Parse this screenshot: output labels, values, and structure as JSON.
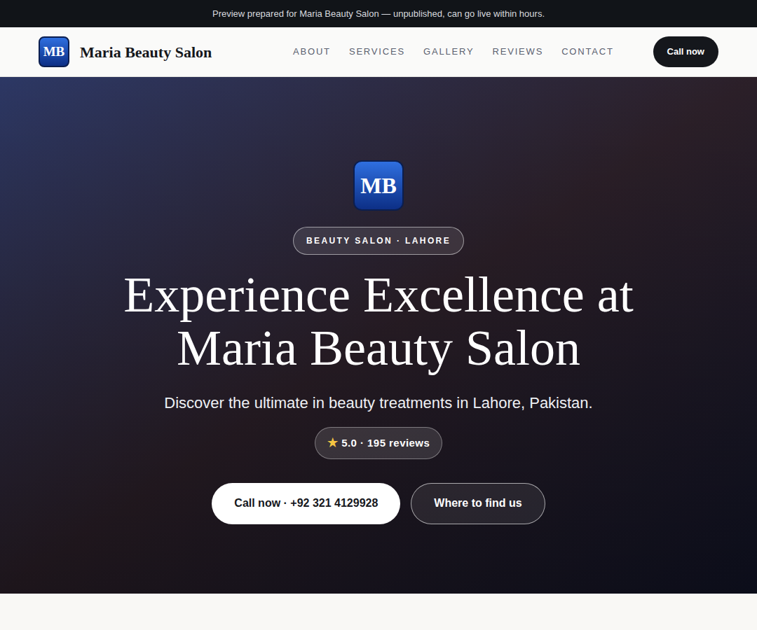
{
  "announcement": "Preview prepared for Maria Beauty Salon — unpublished, can go live within hours.",
  "header": {
    "logo": "MB",
    "title": "Maria Beauty Salon",
    "nav": [
      "ABOUT",
      "SERVICES",
      "GALLERY",
      "REVIEWS",
      "CONTACT"
    ],
    "cta": "Call now"
  },
  "hero": {
    "logo": "MB",
    "badge": "BEAUTY SALON · LAHORE",
    "heading": "Experience Excellence at Maria Beauty Salon",
    "subtitle": "Discover the ultimate in beauty treatments in Lahore, Pakistan.",
    "rating": {
      "icon": "★",
      "text": "5.0 · 195 reviews"
    },
    "buttons": [
      {
        "label": "Call now · +92 321 4129928",
        "kind": "primary"
      },
      {
        "label": "Where to find us",
        "kind": "outline"
      }
    ]
  }
}
